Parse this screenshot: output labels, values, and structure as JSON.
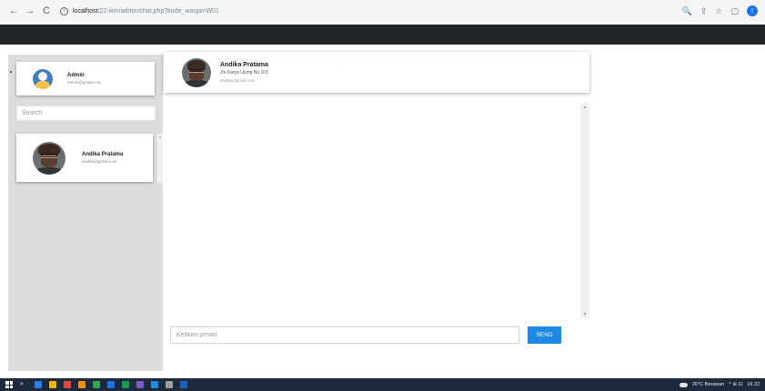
{
  "browser": {
    "back_icon": "←",
    "forward_icon": "→",
    "reload_icon": "C",
    "info_icon": "i",
    "url_host": "localhost",
    "url_path": "/22-ikm/admin/chat.php?kode_warga=W01",
    "icons": {
      "zoom": "🔍",
      "share": "⇪",
      "star": "☆",
      "sidebar": "▢",
      "profile": "!"
    }
  },
  "sidebar": {
    "admin": {
      "name": "Admin",
      "email": "admin@gmail.com"
    },
    "search_placeholder": "Search",
    "contacts": [
      {
        "name": "Andika Pratama",
        "email": "andika@gmail.com"
      }
    ]
  },
  "chat": {
    "header": {
      "name": "Andika Pratama",
      "address": "Jln Karya Ujung No 103",
      "email": "andika@gmail.com"
    },
    "stray_mark": "·",
    "input_placeholder": "Ketikan pesan",
    "send_label": "SEND",
    "scroll_up": "▲",
    "scroll_down": "▼"
  },
  "taskbar": {
    "weather": "26°C Berawan",
    "tray_icons": "^ ⊕ ⊡",
    "time": "19.32",
    "app_colors": [
      "#2b7de9",
      "#f4b400",
      "#e8453c",
      "#ff8c00",
      "#34a853",
      "#1a73e8",
      "#0f9d58",
      "#7e57c2",
      "#1e88e5",
      "#9e9e9e",
      "#1565c0"
    ]
  }
}
